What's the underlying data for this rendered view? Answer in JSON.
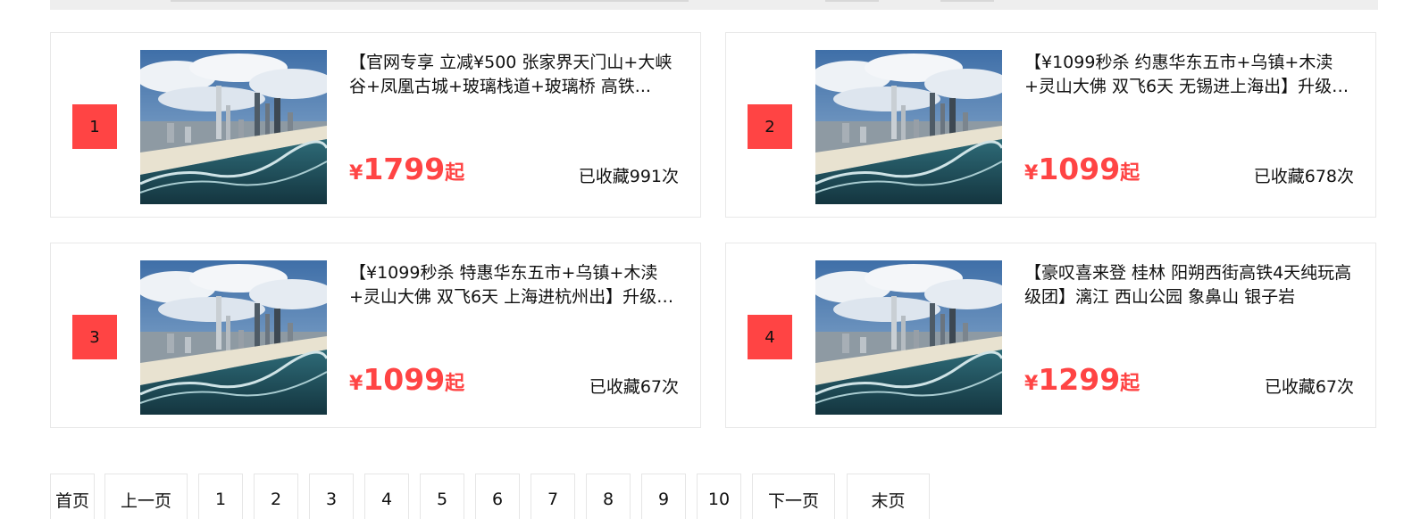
{
  "colors": {
    "accent": "#ff4444",
    "border": "#e8e8e8",
    "top_strip": "#eeeeee"
  },
  "products": [
    {
      "rank": "1",
      "title": "【官网专享 立减¥500 张家界天门山+大峡谷+凤凰古城+玻璃栈道+玻璃桥 高铁...",
      "price_symbol": "¥",
      "price": "1799",
      "price_suffix": "起",
      "favorites": "已收藏991次",
      "image_icon": "city-beach-photo"
    },
    {
      "rank": "2",
      "title": "【¥1099秒杀 约惠华东五市+乌镇+木渎+灵山大佛 双飞6天 无锡进上海出】升级2...",
      "price_symbol": "¥",
      "price": "1099",
      "price_suffix": "起",
      "favorites": "已收藏678次",
      "image_icon": "city-beach-photo"
    },
    {
      "rank": "3",
      "title": "【¥1099秒杀 特惠华东五市+乌镇+木渎+灵山大佛 双飞6天 上海进杭州出】升级2...",
      "price_symbol": "¥",
      "price": "1099",
      "price_suffix": "起",
      "favorites": "已收藏67次",
      "image_icon": "city-beach-photo"
    },
    {
      "rank": "4",
      "title": "【豪叹喜来登 桂林 阳朔西街高铁4天纯玩高级团】漓江 西山公园 象鼻山 银子岩",
      "price_symbol": "¥",
      "price": "1299",
      "price_suffix": "起",
      "favorites": "已收藏67次",
      "image_icon": "city-beach-photo"
    }
  ],
  "pagination": {
    "first": "首页",
    "prev": "上一页",
    "pages": [
      "1",
      "2",
      "3",
      "4",
      "5",
      "6",
      "7",
      "8",
      "9",
      "10"
    ],
    "next": "下一页",
    "last": "末页"
  }
}
